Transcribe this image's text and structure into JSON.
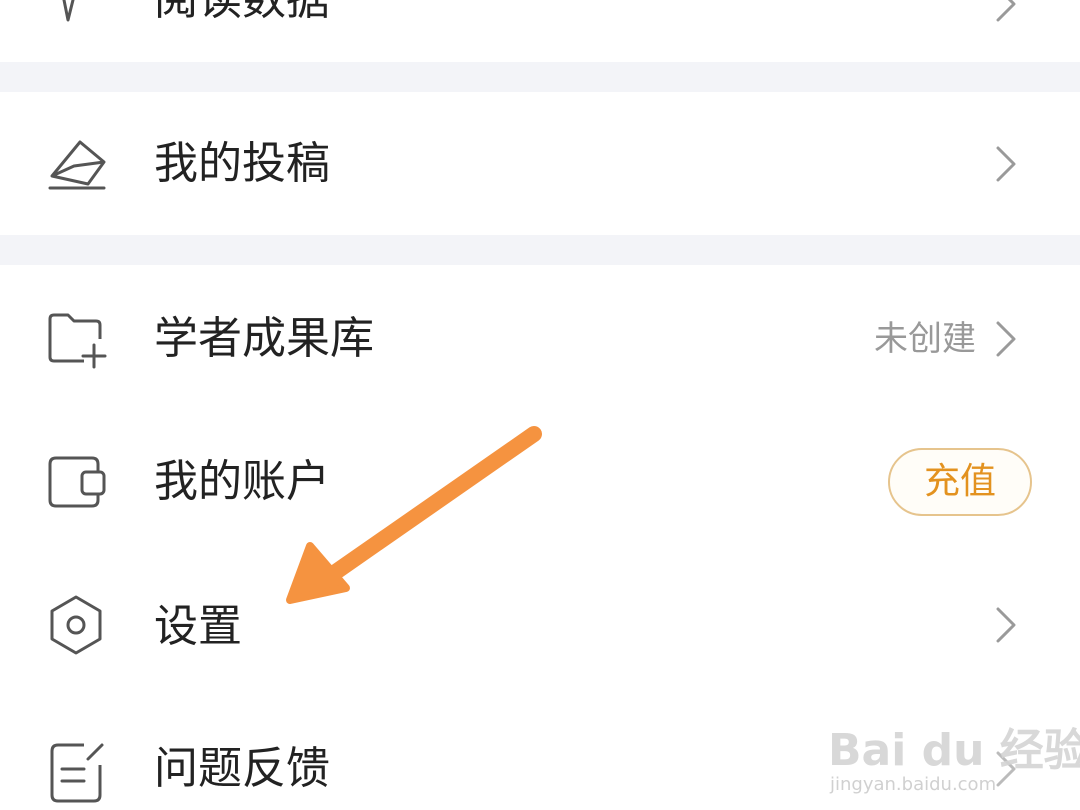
{
  "menu": {
    "items": [
      {
        "label": "阅读数据",
        "icon": "chart-pen-icon"
      },
      {
        "label": "我的投稿",
        "icon": "envelope-icon"
      },
      {
        "label": "学者成果库",
        "icon": "folder-plus-icon",
        "status": "未创建"
      },
      {
        "label": "我的账户",
        "icon": "wallet-icon",
        "action": "充值"
      },
      {
        "label": "设置",
        "icon": "hexagon-settings-icon"
      },
      {
        "label": "问题反馈",
        "icon": "feedback-note-icon"
      }
    ]
  },
  "watermark": {
    "main": "Bai du 经验",
    "sub": "jingyan.baidu.com"
  },
  "colors": {
    "separator": "#f3f4f8",
    "label": "#222222",
    "muted": "#999999",
    "accent": "#e3921f",
    "arrow": "#f59340"
  }
}
